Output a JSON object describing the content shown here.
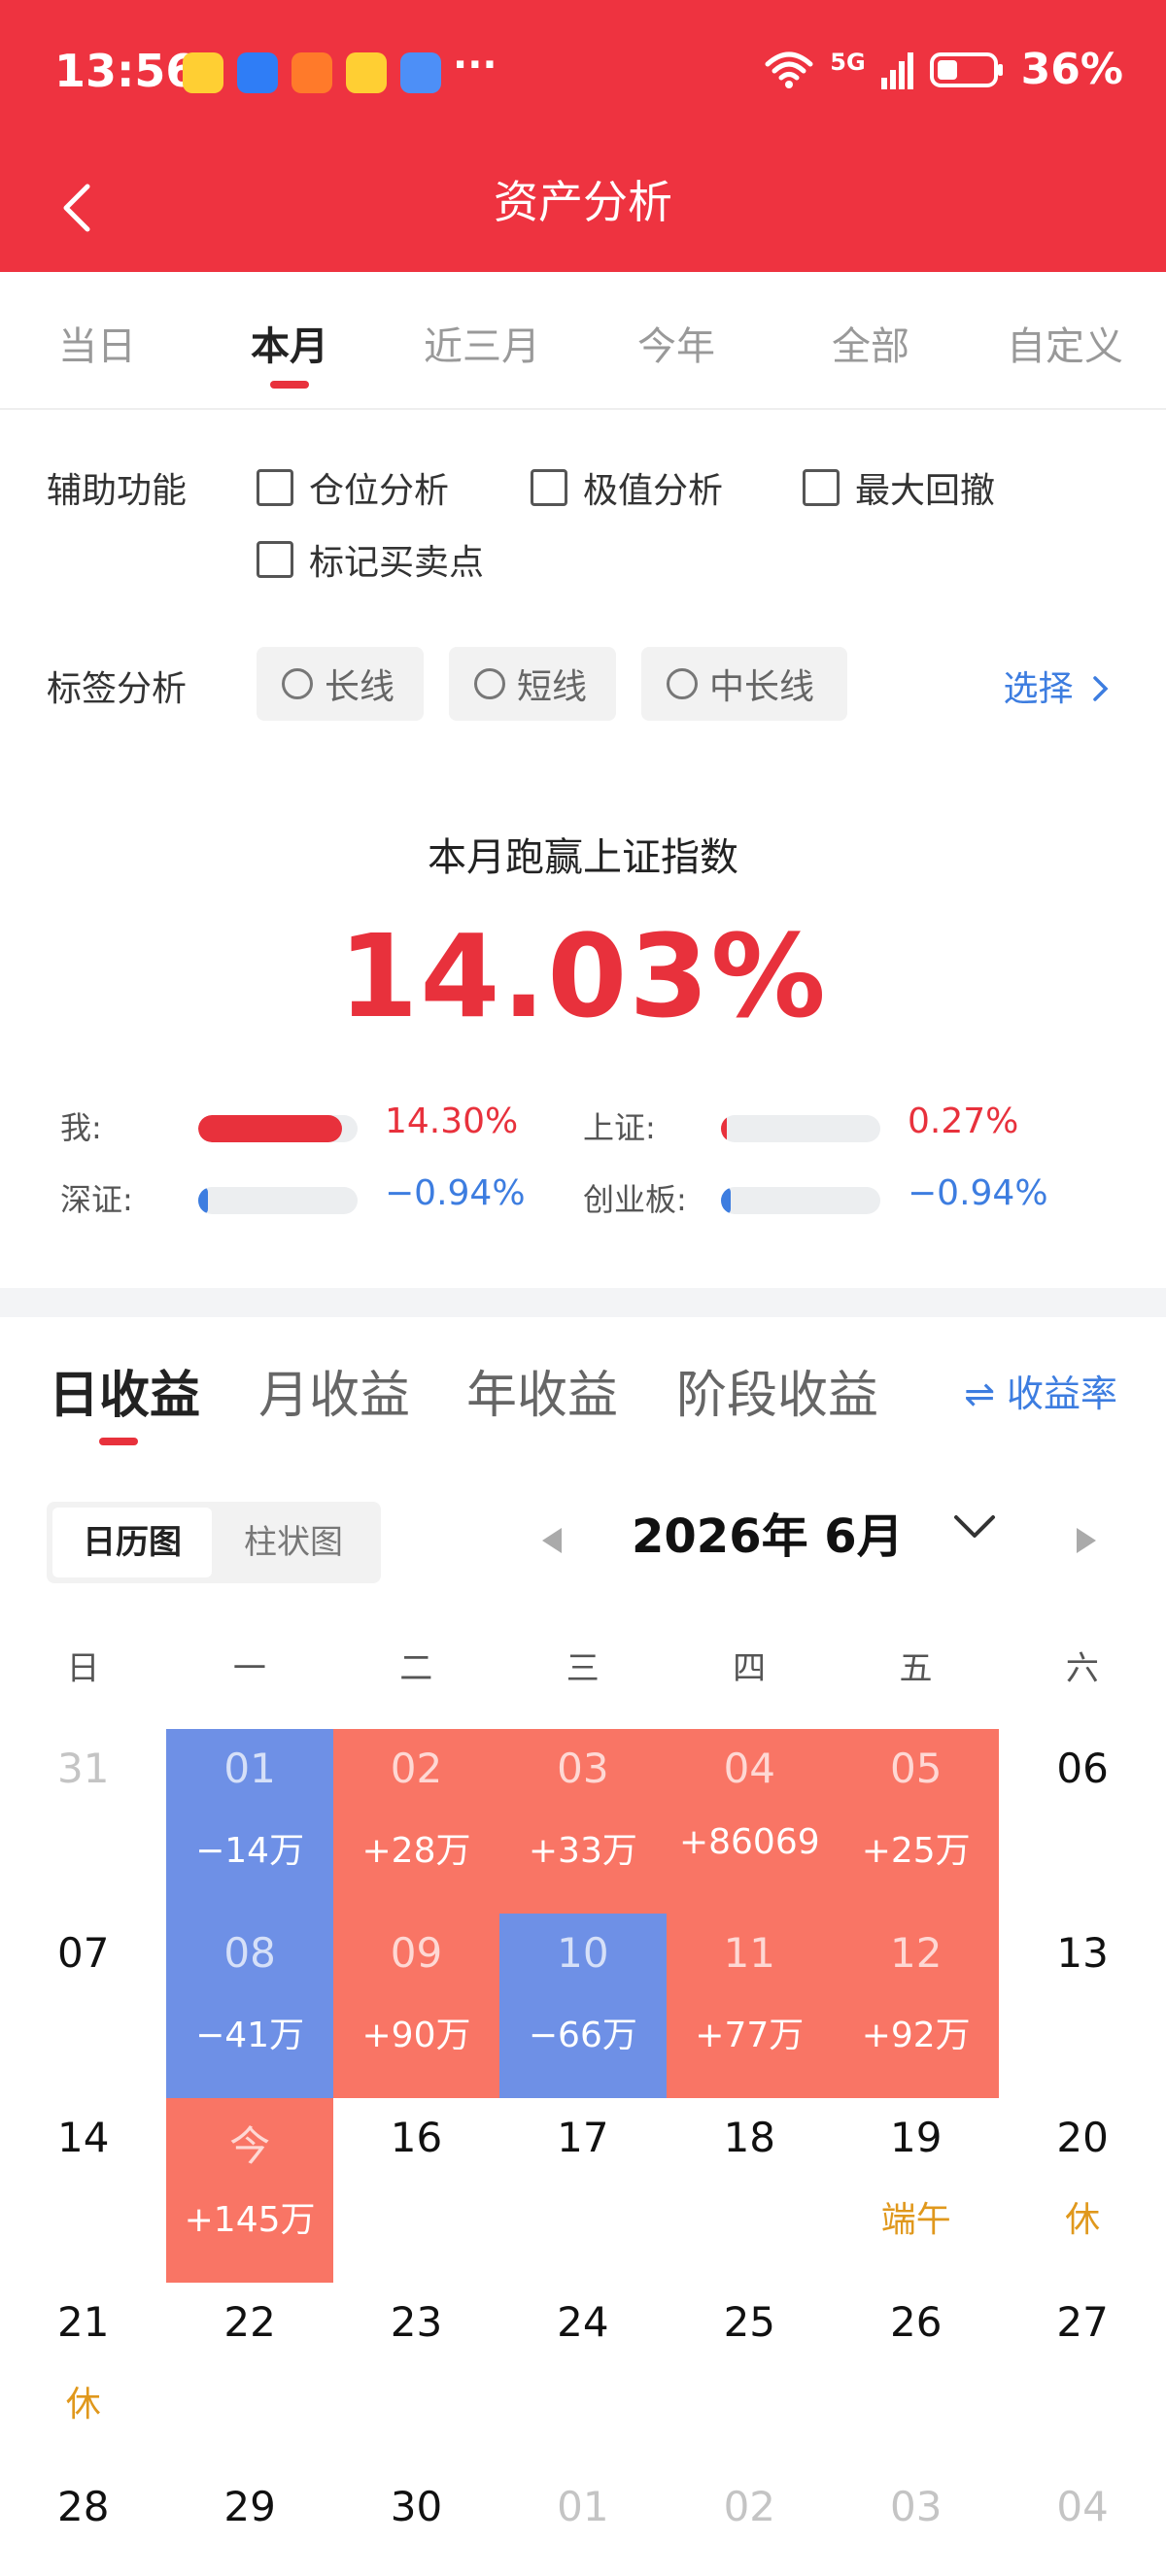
{
  "status_bar": {
    "time": "13:56",
    "network": "5G",
    "battery": "36%",
    "more": "···"
  },
  "header": {
    "title": "资产分析"
  },
  "period_tabs": [
    {
      "label": "当日",
      "active": false
    },
    {
      "label": "本月",
      "active": true
    },
    {
      "label": "近三月",
      "active": false
    },
    {
      "label": "今年",
      "active": false
    },
    {
      "label": "全部",
      "active": false
    },
    {
      "label": "自定义",
      "active": false
    }
  ],
  "assist": {
    "label": "辅助功能",
    "options": [
      "仓位分析",
      "极值分析",
      "最大回撤",
      "标记买卖点"
    ]
  },
  "tag_analysis": {
    "label": "标签分析",
    "tags": [
      "长线",
      "短线",
      "中长线"
    ],
    "select_label": "选择"
  },
  "beat": {
    "title": "本月跑赢上证指数",
    "value": "14.03%"
  },
  "compare": [
    {
      "label": "我:",
      "value": "14.30%",
      "fill": 0.9,
      "color": "#e8313c",
      "tone": "red"
    },
    {
      "label": "上证:",
      "value": "0.27%",
      "fill": 0.02,
      "color": "#e8313c",
      "tone": "red"
    },
    {
      "label": "深证:",
      "value": "−0.94%",
      "fill": 0.06,
      "color": "#3d7de0",
      "tone": "blue"
    },
    {
      "label": "创业板:",
      "value": "−0.94%",
      "fill": 0.06,
      "color": "#3d7de0",
      "tone": "blue"
    }
  ],
  "income_tabs": [
    "日收益",
    "月收益",
    "年收益",
    "阶段收益"
  ],
  "rate_toggle": "⇌ 收益率",
  "view_toggle": [
    "日历图",
    "柱状图"
  ],
  "month_label": "2026年 6月",
  "weekdays": [
    "日",
    "一",
    "二",
    "三",
    "四",
    "五",
    "六"
  ],
  "calendar": [
    [
      {
        "d": "31",
        "muted": true
      },
      {
        "d": "01",
        "amt": "−14万",
        "type": "neg"
      },
      {
        "d": "02",
        "amt": "+28万",
        "type": "pos"
      },
      {
        "d": "03",
        "amt": "+33万",
        "type": "pos"
      },
      {
        "d": "04",
        "amt": "+86069",
        "type": "pos"
      },
      {
        "d": "05",
        "amt": "+25万",
        "type": "pos"
      },
      {
        "d": "06"
      }
    ],
    [
      {
        "d": "07"
      },
      {
        "d": "08",
        "amt": "−41万",
        "type": "neg"
      },
      {
        "d": "09",
        "amt": "+90万",
        "type": "pos"
      },
      {
        "d": "10",
        "amt": "−66万",
        "type": "neg"
      },
      {
        "d": "11",
        "amt": "+77万",
        "type": "pos"
      },
      {
        "d": "12",
        "amt": "+92万",
        "type": "pos"
      },
      {
        "d": "13"
      }
    ],
    [
      {
        "d": "14"
      },
      {
        "d": "今",
        "amt": "+145万",
        "type": "pos"
      },
      {
        "d": "16"
      },
      {
        "d": "17"
      },
      {
        "d": "18"
      },
      {
        "d": "19",
        "note": "端午"
      },
      {
        "d": "20",
        "note": "休"
      }
    ],
    [
      {
        "d": "21",
        "note": "休"
      },
      {
        "d": "22"
      },
      {
        "d": "23"
      },
      {
        "d": "24"
      },
      {
        "d": "25"
      },
      {
        "d": "26"
      },
      {
        "d": "27"
      }
    ],
    [
      {
        "d": "28"
      },
      {
        "d": "29"
      },
      {
        "d": "30"
      },
      {
        "d": "01",
        "muted": true
      },
      {
        "d": "02",
        "muted": true
      },
      {
        "d": "03",
        "muted": true
      },
      {
        "d": "04",
        "muted": true
      }
    ]
  ]
}
